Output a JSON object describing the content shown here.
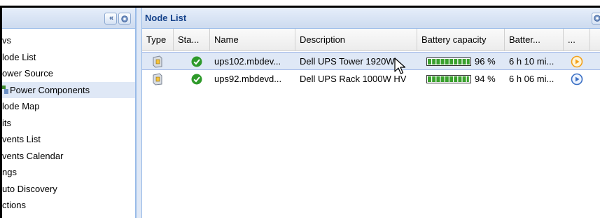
{
  "nav": {
    "items": [
      {
        "label": "vs",
        "selected": false
      },
      {
        "label": "lode List",
        "selected": false
      },
      {
        "label": "ower Source",
        "selected": false
      },
      {
        "label": "Power Components",
        "selected": true
      },
      {
        "label": "lode Map",
        "selected": false
      },
      {
        "label": "its",
        "selected": false
      },
      {
        "label": "vents List",
        "selected": false
      },
      {
        "label": "vents Calendar",
        "selected": false
      },
      {
        "label": "ngs",
        "selected": false
      },
      {
        "label": "uto Discovery",
        "selected": false
      },
      {
        "label": "ctions",
        "selected": false
      }
    ]
  },
  "panel": {
    "title": "Node List"
  },
  "grid": {
    "columns": [
      "Type",
      "Sta...",
      "Name",
      "Description",
      "Battery capacity",
      "Batter...",
      "..."
    ],
    "rows": [
      {
        "name": "ups102.mbdev...",
        "description": "Dell UPS Tower 1920W...",
        "battery_capacity": "96 %",
        "battery_fill": 0.96,
        "battery_time": "6 h 10 mi...",
        "selected": true
      },
      {
        "name": "ups92.mbdevd...",
        "description": "Dell UPS Rack 1000W HV",
        "battery_capacity": "94 %",
        "battery_fill": 0.94,
        "battery_time": "6 h 06 mi...",
        "selected": false
      }
    ]
  },
  "colors": {
    "header_text": "#15428b",
    "status_ok": "#2e9a2a",
    "battery_green": "#3aa12e",
    "play_orange": "#f2a11a",
    "play_blue": "#3a6fc4"
  }
}
